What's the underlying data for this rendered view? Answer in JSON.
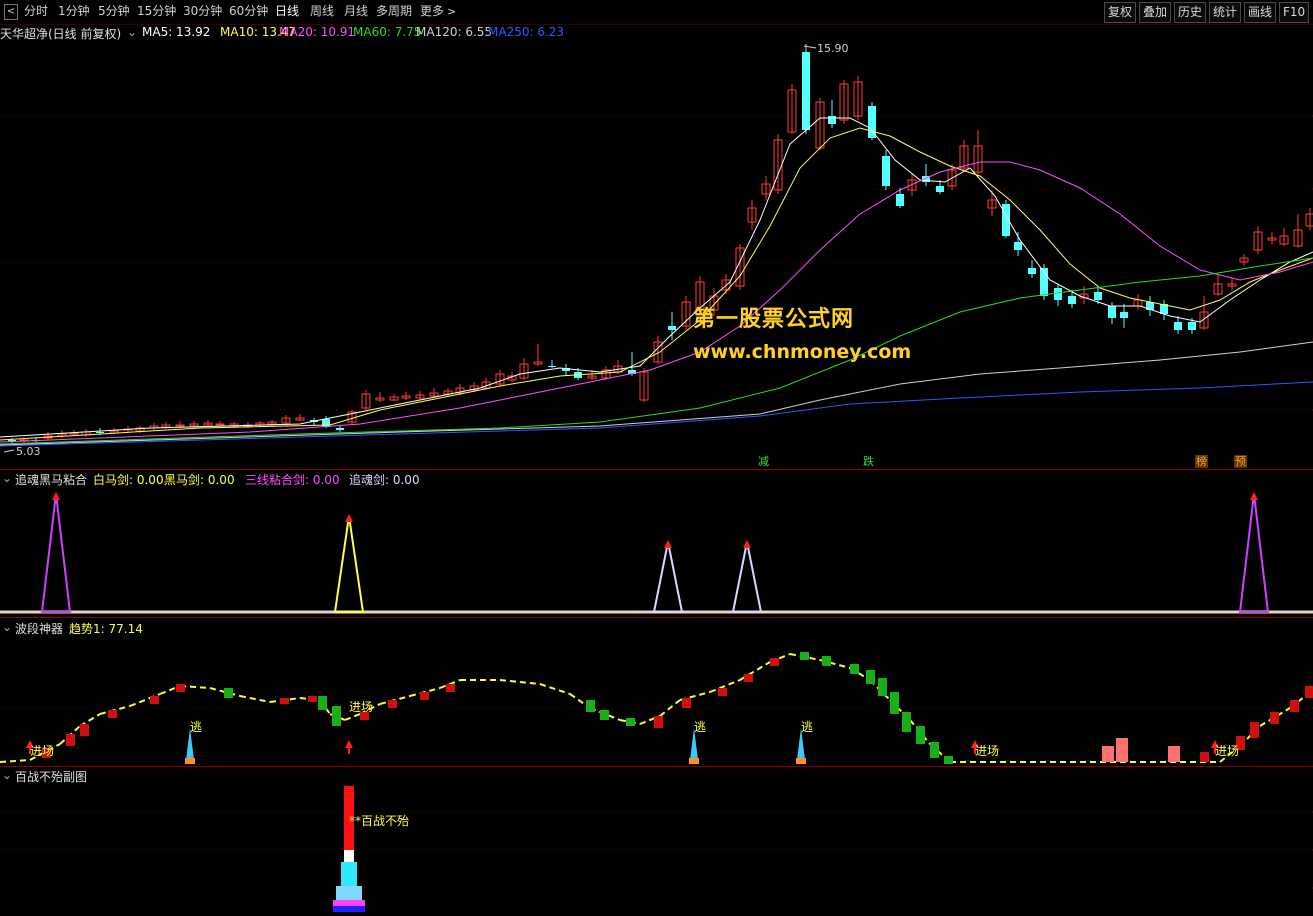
{
  "toolbar": {
    "back_icon": "back-arrow-icon",
    "periods": [
      "分时",
      "1分钟",
      "5分钟",
      "15分钟",
      "30分钟",
      "60分钟",
      "日线",
      "周线",
      "月线",
      "多周期",
      "更多"
    ],
    "active_period": "日线",
    "right_buttons": [
      "复权",
      "叠加",
      "历史",
      "统计",
      "画线",
      "F10"
    ]
  },
  "main_panel": {
    "stock_title": "天华超净(日线 前复权)",
    "ma": [
      {
        "label": "MA5: 13.92",
        "color": "#ffffff"
      },
      {
        "label": "MA10: 13.47",
        "color": "#ffff4a"
      },
      {
        "label": "MA20: 10.91",
        "color": "#ff4dff"
      },
      {
        "label": "MA60: 7.75",
        "color": "#22dd22"
      },
      {
        "label": "MA120: 6.55",
        "color": "#d0d0d0"
      },
      {
        "label": "MA250: 6.23",
        "color": "#3355ff"
      }
    ],
    "high_label": "15.90",
    "low_label": "5.03",
    "watermark_title": "第一股票公式网",
    "watermark_url": "www.chnmoney.com",
    "markers": [
      {
        "text": "减",
        "color": "#3ddc3d"
      },
      {
        "text": "跌",
        "color": "#3ddc3d"
      },
      {
        "text": "榜",
        "color": "#ff9a2a"
      },
      {
        "text": "预",
        "color": "#ff9a2a"
      }
    ]
  },
  "panel2": {
    "title": "追魂黑马粘合",
    "items": [
      {
        "label": "白马剑: 0.00",
        "color": "#ffff4a"
      },
      {
        "label": "黑马剑: 0.00",
        "color": "#ffff4a"
      },
      {
        "label": "三线粘合剑: 0.00",
        "color": "#ff4dff"
      },
      {
        "label": "追魂剑: 0.00",
        "color": "#d8d8ff"
      }
    ]
  },
  "panel3": {
    "title": "波段神器",
    "trend_label": "趋势1: 77.14",
    "signals": [
      "进场",
      "进场",
      "进场",
      "进场"
    ],
    "escape": [
      "逃",
      "逃",
      "逃"
    ]
  },
  "panel4": {
    "title": "百战不殆副图",
    "label": "**百战不殆"
  },
  "colors": {
    "up": "#ff3c3c",
    "down": "#54ffff",
    "ma5": "#ffffff",
    "ma10": "#ffff4a",
    "ma20": "#ff4dff",
    "ma60": "#22dd22",
    "ma120": "#d0d0d0",
    "ma250": "#3355ff",
    "grid": "#8a0000"
  }
}
